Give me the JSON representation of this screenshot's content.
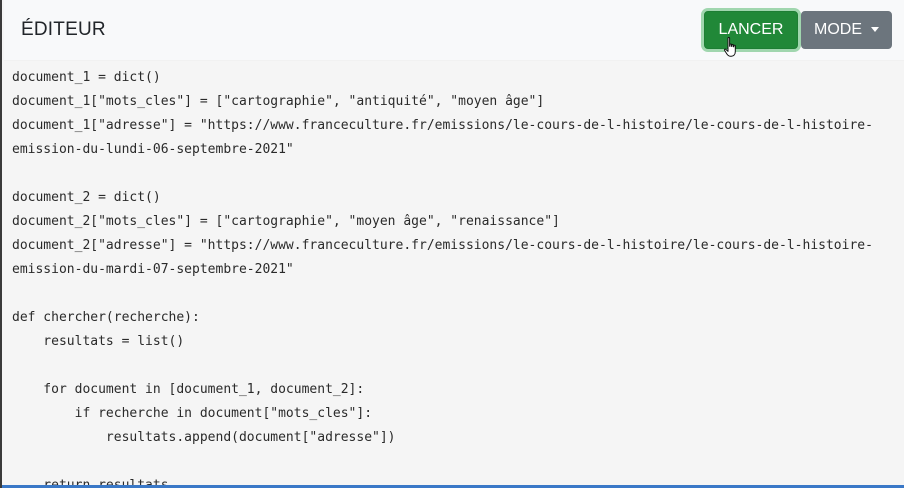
{
  "header": {
    "title": "ÉDITEUR",
    "run_label": "LANCER",
    "mode_label": "MODE"
  },
  "editor": {
    "lines": [
      "document_1 = dict()",
      "document_1[\"mots_cles\"] = [\"cartographie\", \"antiquité\", \"moyen âge\"]",
      "document_1[\"adresse\"] = \"https://www.franceculture.fr/emissions/le-cours-de-l-histoire/le-cours-de-l-histoire-",
      "emission-du-lundi-06-septembre-2021\"",
      "",
      "document_2 = dict()",
      "document_2[\"mots_cles\"] = [\"cartographie\", \"moyen âge\", \"renaissance\"]",
      "document_2[\"adresse\"] = \"https://www.franceculture.fr/emissions/le-cours-de-l-histoire/le-cours-de-l-histoire-",
      "emission-du-mardi-07-septembre-2021\"",
      "",
      "def chercher(recherche):",
      "    resultats = list()",
      "",
      "    for document in [document_1, document_2]:",
      "        if recherche in document[\"mots_cles\"]:",
      "            resultats.append(document[\"adresse\"])",
      "",
      "    return resultats"
    ]
  },
  "colors": {
    "run_button": "#218838",
    "mode_button": "#6c757d",
    "editor_background": "#f5f5f5",
    "header_background": "#f8f9fa"
  },
  "icons": {
    "cursor": "hand-pointer-icon",
    "mode_dropdown": "caret-down-icon"
  }
}
